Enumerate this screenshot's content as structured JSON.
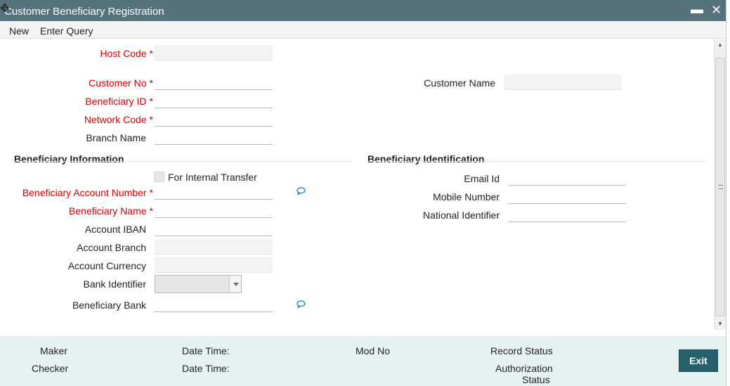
{
  "window": {
    "title": "Customer Beneficiary Registration",
    "minimize_glyph": "▬",
    "close_glyph": "✕"
  },
  "menu": {
    "new_label": "New",
    "enter_query_label": "Enter Query"
  },
  "header_fields": {
    "host_code": {
      "label": "Host Code",
      "value": ""
    },
    "customer_no": {
      "label": "Customer No",
      "value": ""
    },
    "customer_name": {
      "label": "Customer Name",
      "value": ""
    },
    "beneficiary_id": {
      "label": "Beneficiary ID",
      "value": ""
    },
    "network_code": {
      "label": "Network Code",
      "value": ""
    },
    "branch_name": {
      "label": "Branch Name",
      "value": ""
    },
    "required_marker": "*"
  },
  "beneficiary_information": {
    "title": "Beneficiary Information",
    "for_internal_transfer_label": "For Internal Transfer",
    "account_number": {
      "label": "Beneficiary Account Number",
      "value": ""
    },
    "beneficiary_name": {
      "label": "Beneficiary Name",
      "value": ""
    },
    "account_iban": {
      "label": "Account IBAN",
      "value": ""
    },
    "account_branch": {
      "label": "Account Branch",
      "value": ""
    },
    "account_currency": {
      "label": "Account Currency",
      "value": ""
    },
    "bank_identifier": {
      "label": "Bank Identifier",
      "value": ""
    },
    "beneficiary_bank": {
      "label": "Beneficiary Bank",
      "value": ""
    }
  },
  "beneficiary_identification": {
    "title": "Beneficiary Identification",
    "email_id": {
      "label": "Email Id",
      "value": ""
    },
    "mobile_number": {
      "label": "Mobile Number",
      "value": ""
    },
    "national_identifier": {
      "label": "National Identifier",
      "value": ""
    }
  },
  "footer": {
    "maker": "Maker",
    "checker": "Checker",
    "date_time_1": "Date Time:",
    "date_time_2": "Date Time:",
    "mod_no": "Mod No",
    "record_status": "Record Status",
    "authorization_status_1": "Authorization",
    "authorization_status_2": "Status",
    "exit_label": "Exit"
  },
  "colors": {
    "title_bar": "#56737c",
    "required_label": "#cc0000",
    "footer_bg": "#e6f1f1",
    "exit_button": "#26606a"
  },
  "icons": {
    "lookup": "chat-bubble-icon",
    "cursor": "move-cursor-icon"
  }
}
